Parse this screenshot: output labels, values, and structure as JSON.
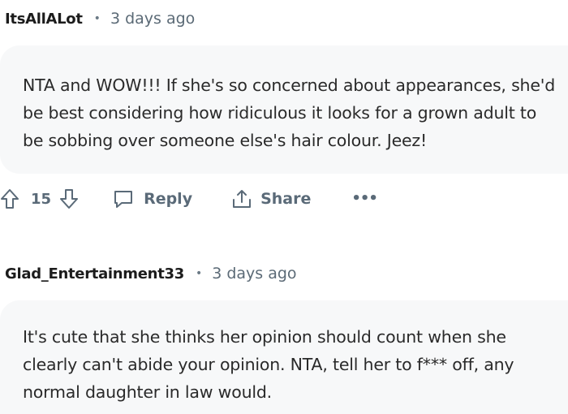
{
  "comments": [
    {
      "author": "ItsAllALot",
      "separator": "•",
      "age": "3 days ago",
      "body": "NTA and WOW!!! If she's so concerned about appearances, she'd be best considering how ridiculous it looks for a grown adult to be sobbing over someone else's hair colour. Jeez!",
      "votes": "15",
      "reply_label": "Reply",
      "share_label": "Share",
      "more_label": "•••"
    },
    {
      "author": "Glad_Entertainment33",
      "separator": "•",
      "age": "3 days ago",
      "body": "It's cute that she thinks her opinion should count when she clearly can't abide your opinion. NTA, tell her to f*** off, any normal daughter in law would."
    }
  ],
  "colors": {
    "bubble_bg": "#f7f8f9",
    "meta_text": "#5b6a76",
    "action_text": "#5a6a78"
  },
  "icons": [
    "upvote-icon",
    "downvote-icon",
    "reply-icon",
    "share-icon",
    "more-icon"
  ]
}
